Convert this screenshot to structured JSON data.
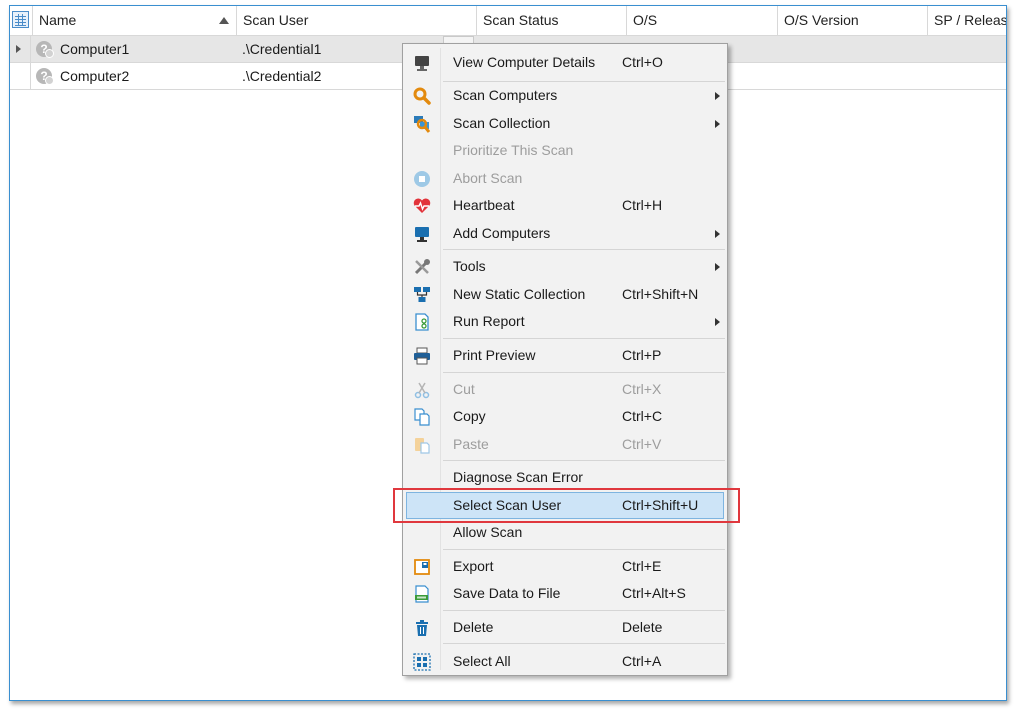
{
  "table": {
    "columns": [
      "Name",
      "Scan User",
      "Scan Status",
      "O/S",
      "O/S Version",
      "SP / Releas"
    ],
    "rows": [
      {
        "name": "Computer1",
        "scan_user": ".\\Credential1"
      },
      {
        "name": "Computer2",
        "scan_user": ".\\Credential2"
      }
    ]
  },
  "menu": {
    "items": [
      {
        "label": "View Computer Details",
        "shortcut": "Ctrl+O",
        "icon": "monitor-icon"
      },
      {
        "label": "Scan Computers",
        "icon": "magnifier-icon"
      },
      {
        "label": "Scan Collection",
        "icon": "scan-collection-icon"
      },
      {
        "label": "Prioritize This Scan"
      },
      {
        "label": "Abort Scan",
        "icon": "stop-icon"
      },
      {
        "label": "Heartbeat",
        "shortcut": "Ctrl+H",
        "icon": "heart-icon"
      },
      {
        "label": "Add Computers",
        "icon": "add-computer-icon"
      },
      {
        "label": "Tools",
        "icon": "tools-icon"
      },
      {
        "label": "New Static Collection",
        "shortcut": "Ctrl+Shift+N",
        "icon": "network-icon"
      },
      {
        "label": "Run Report",
        "icon": "report-icon"
      },
      {
        "label": "Print Preview",
        "shortcut": "Ctrl+P",
        "icon": "printer-icon"
      },
      {
        "label": "Cut",
        "shortcut": "Ctrl+X",
        "icon": "scissors-icon"
      },
      {
        "label": "Copy",
        "shortcut": "Ctrl+C",
        "icon": "copy-icon"
      },
      {
        "label": "Paste",
        "shortcut": "Ctrl+V",
        "icon": "paste-icon"
      },
      {
        "label": "Diagnose Scan Error"
      },
      {
        "label": "Select Scan User",
        "shortcut": "Ctrl+Shift+U"
      },
      {
        "label": "Allow Scan"
      },
      {
        "label": "Export",
        "shortcut": "Ctrl+E",
        "icon": "export-icon"
      },
      {
        "label": "Save Data to File",
        "shortcut": "Ctrl+Alt+S",
        "icon": "csv-file-icon"
      },
      {
        "label": "Delete",
        "shortcut": "Delete",
        "icon": "trash-icon"
      },
      {
        "label": "Select All",
        "shortcut": "Ctrl+A",
        "icon": "select-all-icon"
      }
    ]
  },
  "colors": {
    "accent": "#3a8fd0",
    "highlight": "#cde4f7",
    "callout": "#e0383e"
  }
}
